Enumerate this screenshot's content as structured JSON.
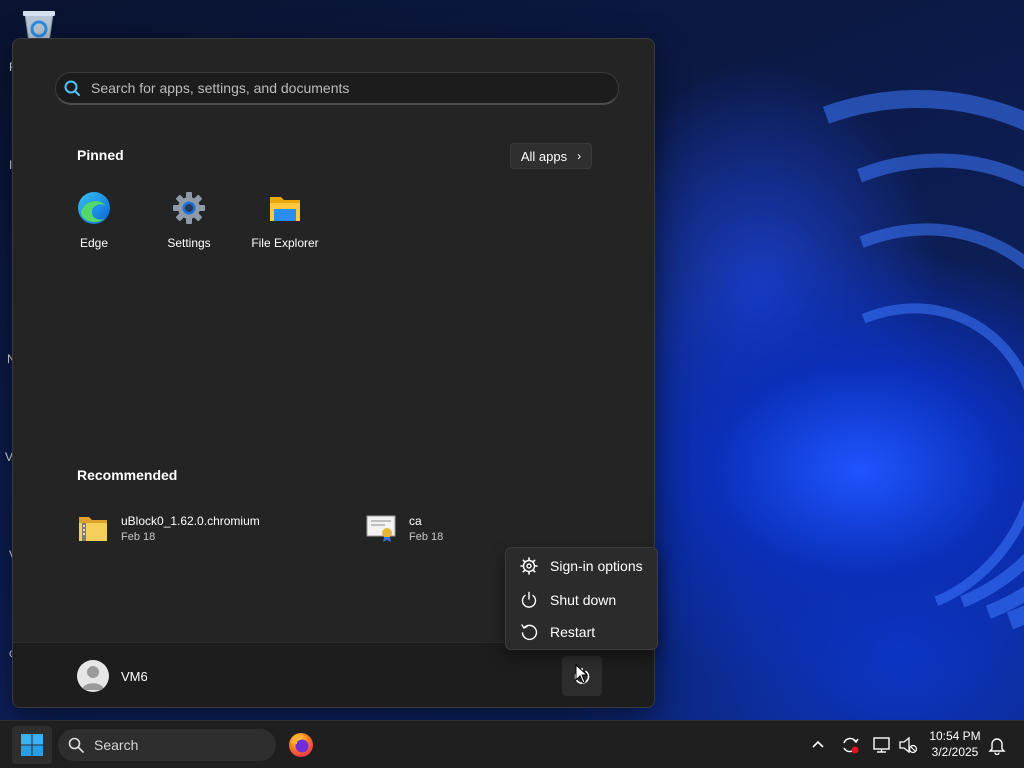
{
  "start_menu": {
    "search": {
      "placeholder": "Search for apps, settings, and documents"
    },
    "pinned": {
      "title": "Pinned",
      "all_apps_label": "All apps",
      "apps": [
        {
          "label": "Edge",
          "icon": "edge-icon"
        },
        {
          "label": "Settings",
          "icon": "gear-icon"
        },
        {
          "label": "File Explorer",
          "icon": "folder-icon"
        }
      ]
    },
    "recommended": {
      "title": "Recommended",
      "items": [
        {
          "name": "uBlock0_1.62.0.chromium",
          "date": "Feb 18",
          "icon": "zip-folder-icon"
        },
        {
          "name": "ca",
          "date": "Feb 18",
          "icon": "certificate-icon"
        }
      ]
    },
    "user": {
      "name": "VM6"
    }
  },
  "power_menu": {
    "items": [
      {
        "label": "Sign-in options",
        "icon": "gear-icon"
      },
      {
        "label": "Shut down",
        "icon": "power-icon"
      },
      {
        "label": "Restart",
        "icon": "restart-icon"
      }
    ]
  },
  "taskbar": {
    "search_label": "Search",
    "clock": {
      "time": "10:54 PM",
      "date": "3/2/2025"
    }
  },
  "colors": {
    "menu_bg": "#242424",
    "taskbar_bg": "#1f1f1f",
    "accent_blue": "#1e6fff"
  }
}
